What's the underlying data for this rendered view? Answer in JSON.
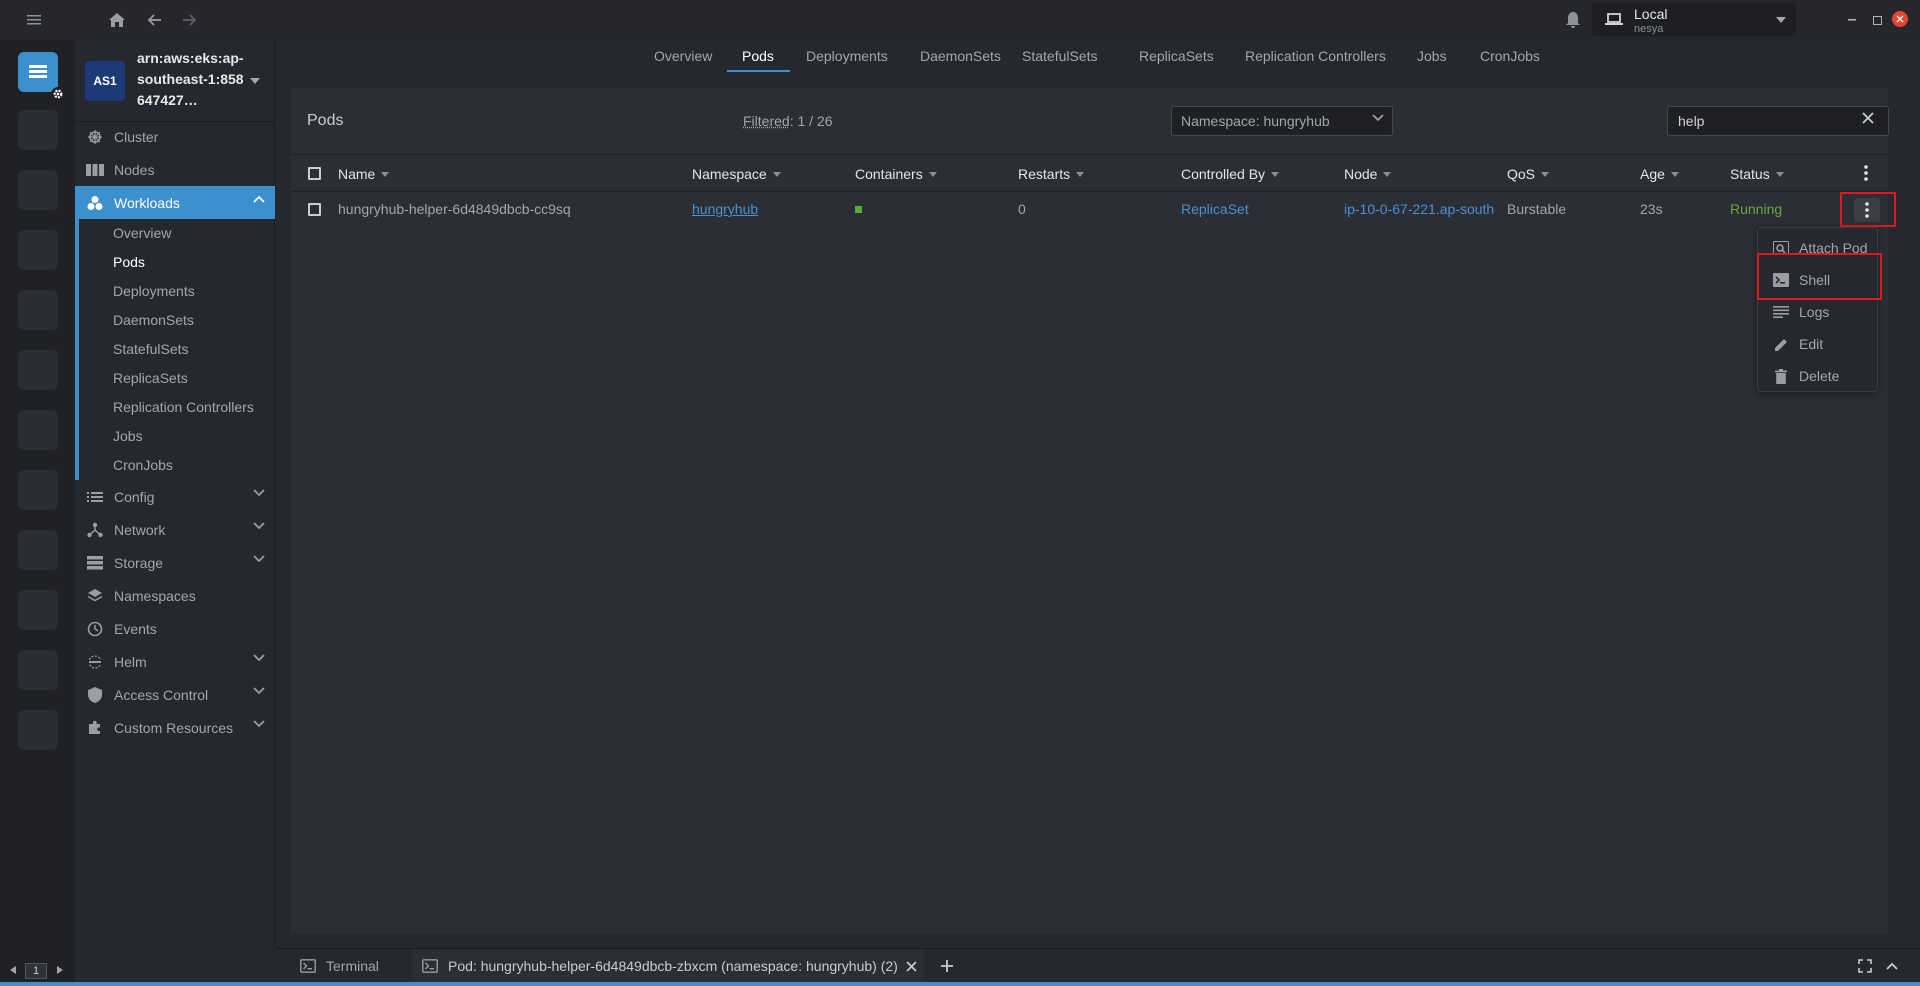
{
  "topbar": {
    "cluster": {
      "name": "Local",
      "user": "nesya"
    }
  },
  "sidebar": {
    "cluster_avatar": "AS1",
    "cluster_title": "arn:aws:eks:ap-southeast-1:858647427…",
    "items": [
      {
        "label": "Cluster",
        "icon": "helm-wheel-icon"
      },
      {
        "label": "Nodes",
        "icon": "nodes-icon"
      },
      {
        "label": "Workloads",
        "icon": "workloads-icon"
      },
      {
        "label": "Config",
        "icon": "list-icon"
      },
      {
        "label": "Network",
        "icon": "network-icon"
      },
      {
        "label": "Storage",
        "icon": "storage-icon"
      },
      {
        "label": "Namespaces",
        "icon": "layers-icon"
      },
      {
        "label": "Events",
        "icon": "clock-icon"
      },
      {
        "label": "Helm",
        "icon": "helm-icon"
      },
      {
        "label": "Access Control",
        "icon": "shield-icon"
      },
      {
        "label": "Custom Resources",
        "icon": "puzzle-icon"
      }
    ],
    "workloads_sub": [
      "Overview",
      "Pods",
      "Deployments",
      "DaemonSets",
      "StatefulSets",
      "ReplicaSets",
      "Replication Controllers",
      "Jobs",
      "CronJobs"
    ]
  },
  "tabs": [
    "Overview",
    "Pods",
    "Deployments",
    "DaemonSets",
    "StatefulSets",
    "ReplicaSets",
    "Replication Controllers",
    "Jobs",
    "CronJobs"
  ],
  "panel": {
    "title": "Pods",
    "filter_label": "Filtered",
    "filter_count": ": 1 / 26",
    "namespace_select": "Namespace: hungryhub",
    "search_value": "help"
  },
  "table": {
    "columns": [
      "Name",
      "Namespace",
      "Containers",
      "Restarts",
      "Controlled By",
      "Node",
      "QoS",
      "Age",
      "Status"
    ],
    "rows": [
      {
        "name": "hungryhub-helper-6d4849dbcb-cc9sq",
        "namespace": "hungryhub",
        "restarts": "0",
        "controlled_by": "ReplicaSet",
        "node": "ip-10-0-67-221.ap-south",
        "qos": "Burstable",
        "age": "23s",
        "status": "Running"
      }
    ]
  },
  "context_menu": [
    "Attach Pod",
    "Shell",
    "Logs",
    "Edit",
    "Delete"
  ],
  "dock": {
    "terminal_label": "Terminal",
    "pod_tab_label": "Pod: hungryhub-helper-6d4849dbcb-zbxcm (namespace: hungryhub) (2)"
  },
  "statusbar": {
    "page": "1"
  },
  "colors": {
    "accent": "#3d90ce",
    "running": "#6ba740",
    "link": "#4a90d2",
    "highlight": "#e01a1a"
  }
}
